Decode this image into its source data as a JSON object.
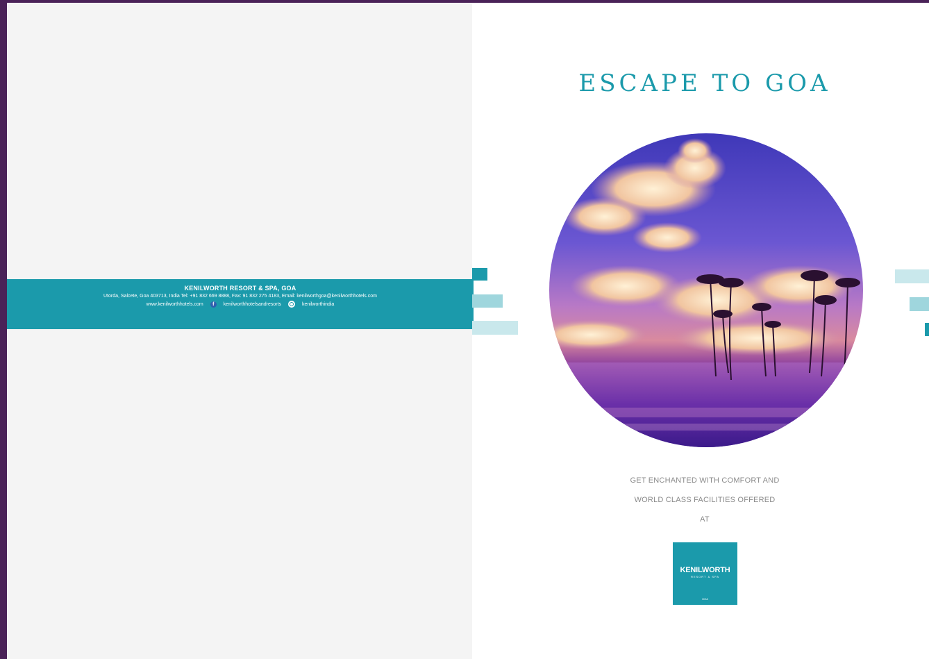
{
  "contact": {
    "hotel_name": "KENILWORTH RESORT & SPA, GOA",
    "address_line": "Utorda, Salcete, Goa 403713, India Tel: +91 832 669 8888, Fax: 91 832 275 4183, Email: kenilworthgoa@kenilworthhotels.com",
    "website": "www.kenilworthhotels.com",
    "facebook": "kenilworthhotelsandresorts",
    "instagram": "kenilworthindia",
    "facebook_icon": "facebook-icon",
    "instagram_icon": "instagram-icon"
  },
  "cover": {
    "title": "ESCAPE TO GOA",
    "tagline_line1": "GET ENCHANTED WITH COMFORT AND",
    "tagline_line2": "WORLD CLASS FACILITIES OFFERED",
    "tagline_line3": "AT"
  },
  "logo": {
    "brand": "KENILWORTH",
    "sub": "RESORT & SPA",
    "city": "GOA"
  },
  "colors": {
    "accent": "#1b9aab",
    "frame": "#4a2258",
    "left_page": "#f4f4f4"
  }
}
